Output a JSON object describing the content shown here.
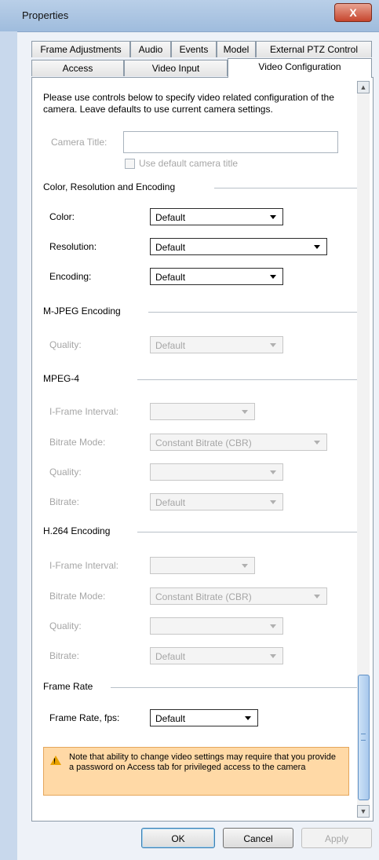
{
  "window": {
    "title": "Properties",
    "close_label": "X"
  },
  "tabs": {
    "row1": [
      "Frame Adjustments",
      "Audio",
      "Events",
      "Model",
      "External PTZ Control"
    ],
    "row2": [
      "Access",
      "Video Input",
      "Video Configuration"
    ],
    "active": "Video Configuration"
  },
  "intro": "Please use controls below to specify video related configuration of the camera. Leave defaults to use current camera settings.",
  "camera_title": {
    "label": "Camera Title:",
    "value": "",
    "checkbox_label": "Use default camera title",
    "checked": false
  },
  "groups": {
    "color_res": {
      "title": "Color, Resolution and Encoding",
      "color_label": "Color:",
      "color_value": "Default",
      "resolution_label": "Resolution:",
      "resolution_value": "Default",
      "encoding_label": "Encoding:",
      "encoding_value": "Default"
    },
    "mjpeg": {
      "title": "M-JPEG Encoding",
      "quality_label": "Quality:",
      "quality_value": "Default"
    },
    "mpeg4": {
      "title": "MPEG-4",
      "iframe_label": "I-Frame Interval:",
      "iframe_value": "",
      "bitrate_mode_label": "Bitrate Mode:",
      "bitrate_mode_value": "Constant Bitrate (CBR)",
      "quality_label": "Quality:",
      "quality_value": "",
      "bitrate_label": "Bitrate:",
      "bitrate_value": "Default"
    },
    "h264": {
      "title": "H.264 Encoding",
      "iframe_label": "I-Frame Interval:",
      "iframe_value": "",
      "bitrate_mode_label": "Bitrate Mode:",
      "bitrate_mode_value": "Constant Bitrate (CBR)",
      "quality_label": "Quality:",
      "quality_value": "",
      "bitrate_label": "Bitrate:",
      "bitrate_value": "Default"
    },
    "frame_rate": {
      "title": "Frame Rate",
      "fps_label": "Frame Rate, fps:",
      "fps_value": "Default"
    }
  },
  "warning": {
    "text": "Note that ability to change video settings may require that you provide a password on Access tab for privileged access to the camera"
  },
  "buttons": {
    "ok": "OK",
    "cancel": "Cancel",
    "apply": "Apply"
  },
  "icons": {
    "close": "close-icon",
    "warning": "warning-icon",
    "dropdown": "chevron-down-icon"
  },
  "colors": {
    "warning_bg": "#ffd9a6",
    "title_bar": "#b9cfe8",
    "close_button": "#c6452d"
  }
}
